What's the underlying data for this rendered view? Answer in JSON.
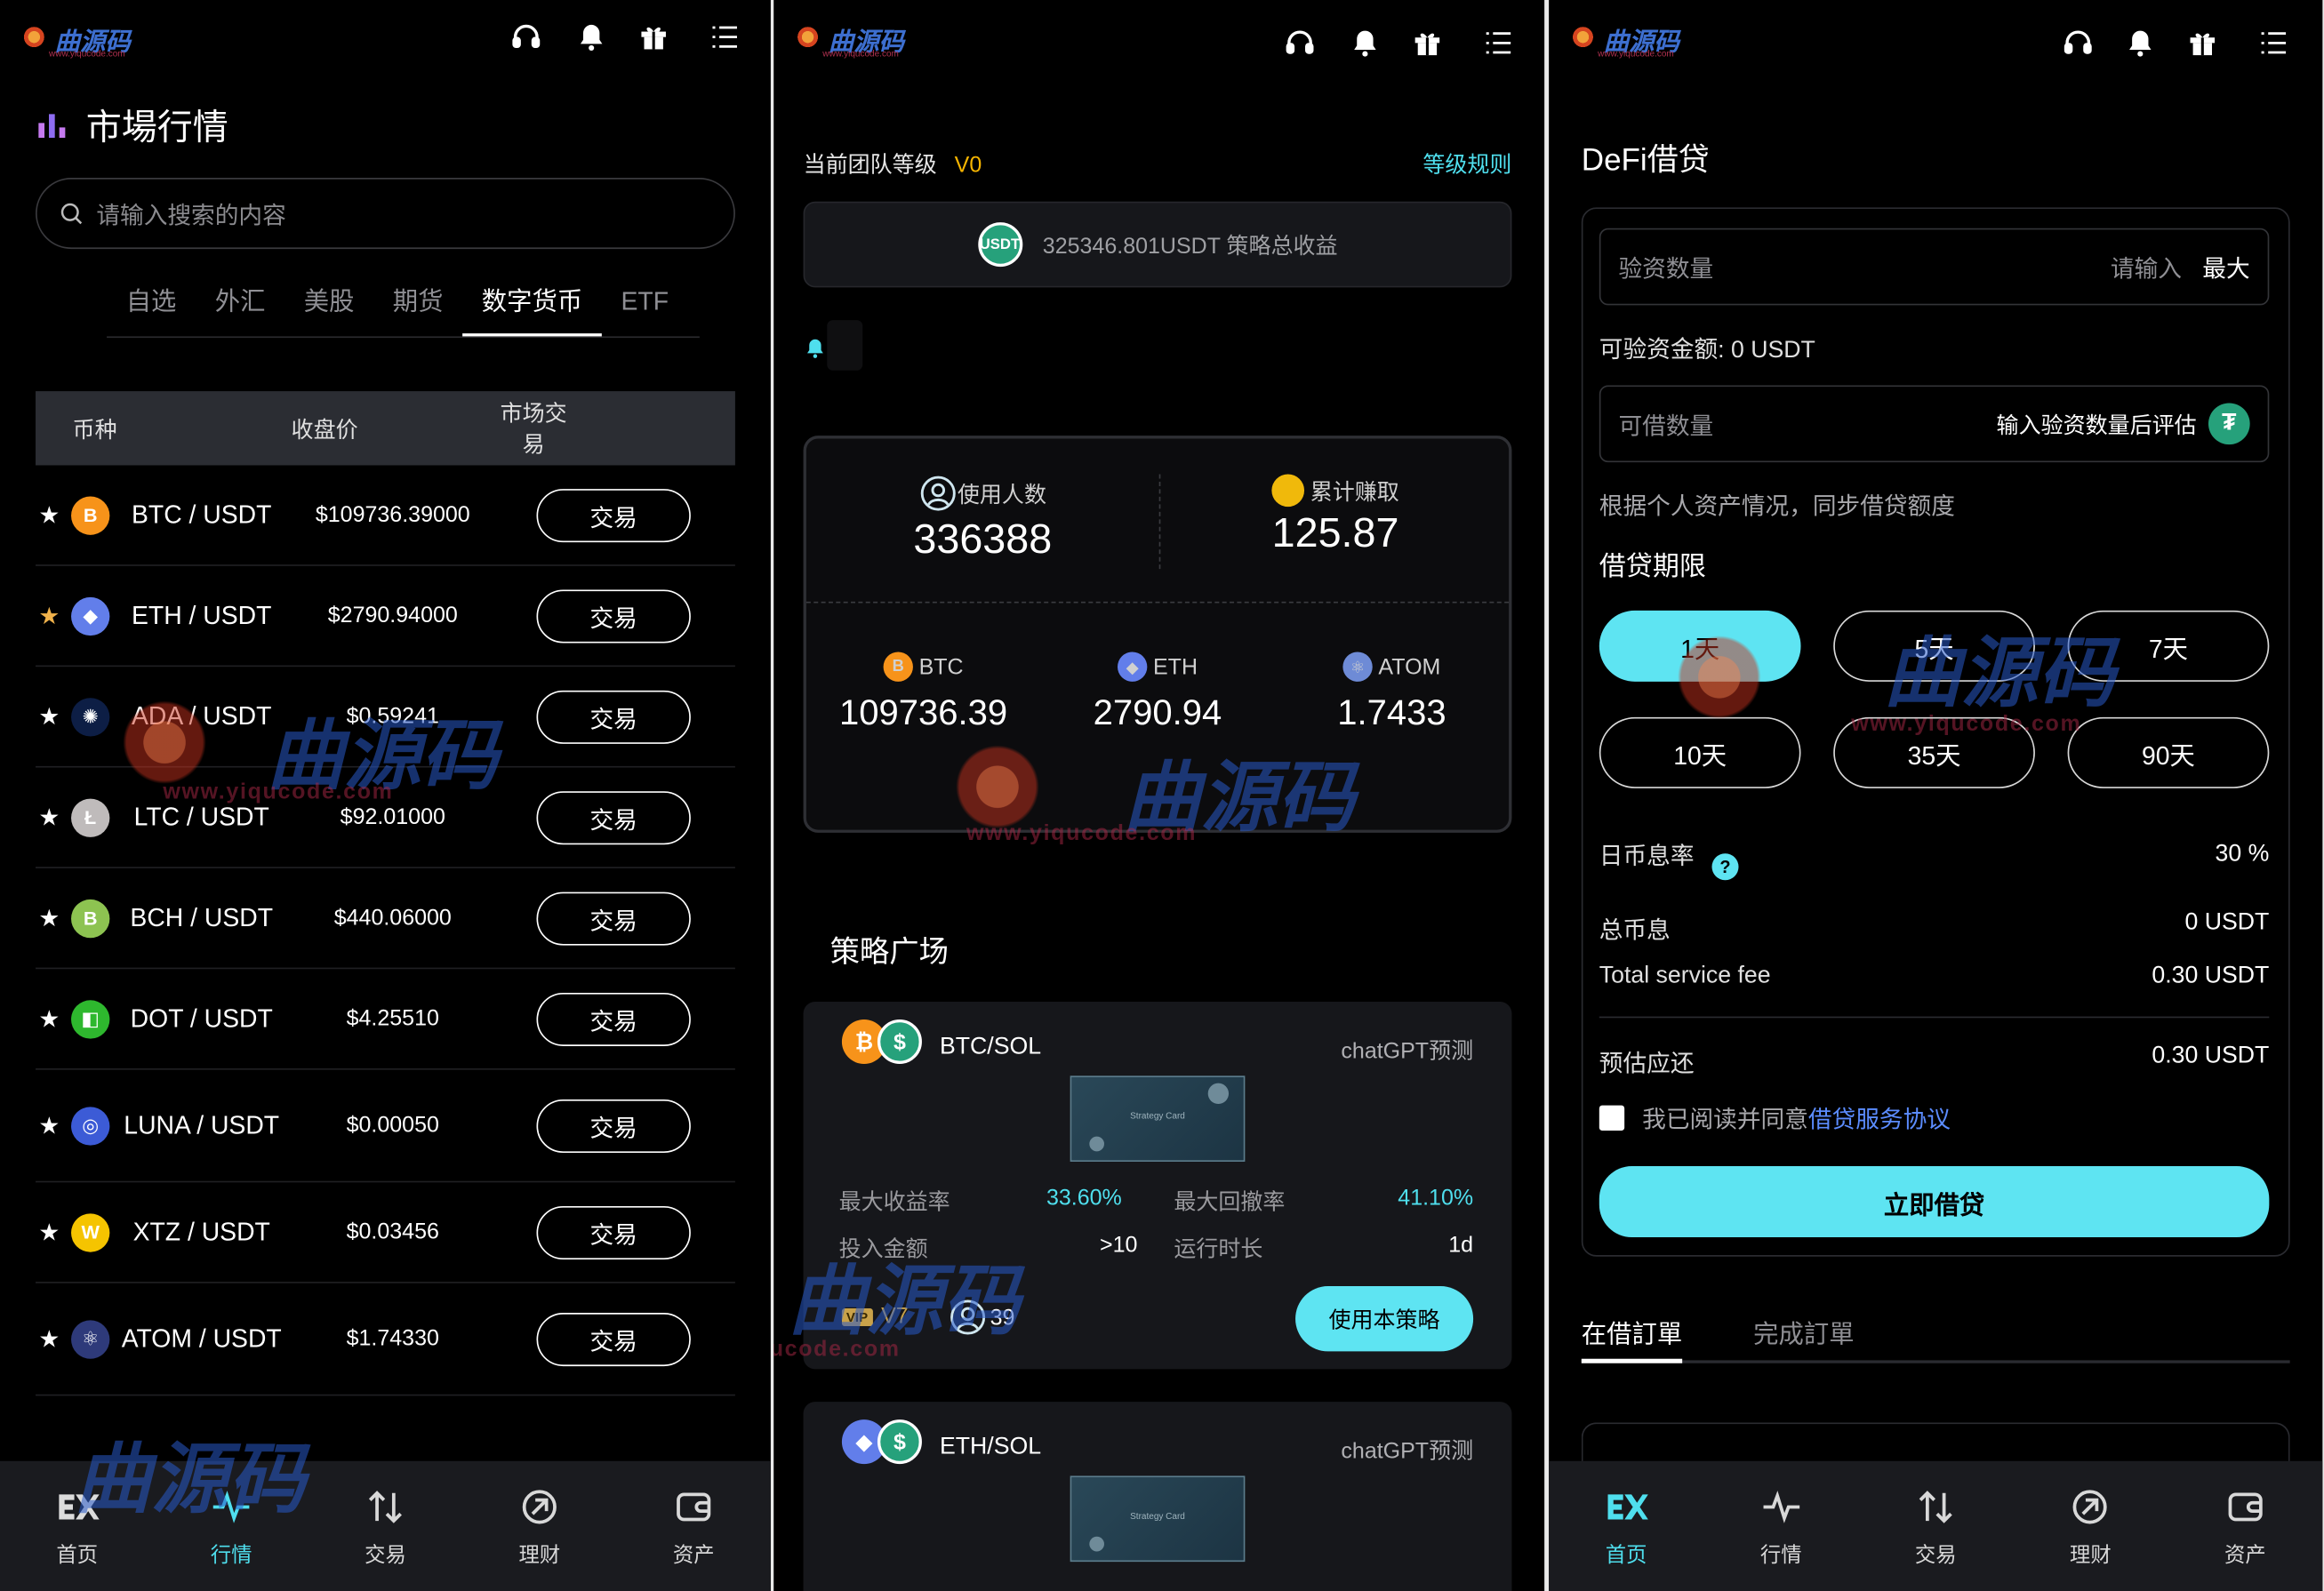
{
  "header_icons": [
    "headset-icon",
    "bell-icon",
    "gift-icon",
    "menu-icon"
  ],
  "watermark": {
    "text": "曲源码",
    "url": "www.yiqucode.com"
  },
  "market": {
    "title": "市場行情",
    "search_placeholder": "请输入搜索的内容",
    "categories": [
      "自选",
      "外汇",
      "美股",
      "期货",
      "数字货币",
      "ETF"
    ],
    "active_category": "数字货币",
    "columns": [
      "币种",
      "收盘价",
      "市场交易"
    ],
    "trade_label": "交易",
    "rows": [
      {
        "pair": "BTC / USDT",
        "price": "$109736.39000",
        "icon": "B",
        "color": "#f7931a",
        "fav": false
      },
      {
        "pair": "ETH / USDT",
        "price": "$2790.94000",
        "icon": "◆",
        "color": "#627eea",
        "fav": true
      },
      {
        "pair": "ADA / USDT",
        "price": "$0.59241",
        "icon": "✺",
        "color": "#0d1e45",
        "fav": false
      },
      {
        "pair": "LTC / USDT",
        "price": "$92.01000",
        "icon": "Ł",
        "color": "#bfbbbb",
        "fav": false
      },
      {
        "pair": "BCH / USDT",
        "price": "$440.06000",
        "icon": "B",
        "color": "#8dc351",
        "fav": false
      },
      {
        "pair": "DOT / USDT",
        "price": "$4.25510",
        "icon": "◧",
        "color": "#2eb82e",
        "fav": false
      },
      {
        "pair": "LUNA / USDT",
        "price": "$0.00050",
        "icon": "◎",
        "color": "#3c5bd6",
        "fav": false
      },
      {
        "pair": "XTZ / USDT",
        "price": "$0.03456",
        "icon": "W",
        "color": "#f5c400",
        "fav": false
      },
      {
        "pair": "ATOM / USDT",
        "price": "$1.74330",
        "icon": "⚛",
        "color": "#2e3a7a",
        "fav": false
      }
    ]
  },
  "tabs_left": [
    {
      "label": "首页",
      "icon": "ex-logo-icon"
    },
    {
      "label": "行情",
      "icon": "pulse-icon"
    },
    {
      "label": "交易",
      "icon": "swap-icon"
    },
    {
      "label": "理财",
      "icon": "finance-icon"
    },
    {
      "label": "资产",
      "icon": "wallet-icon"
    }
  ],
  "team": {
    "level_label": "当前团队等级",
    "level": "V0",
    "rules_link": "等级规则",
    "total_earn": "325346.801USDT 策略总收益",
    "usdt_badge": "USDT",
    "users_label": "使用人数",
    "users": "336388",
    "earned_label": "累计赚取",
    "earned": "125.87",
    "prices": [
      {
        "name": "BTC",
        "value": "109736.39",
        "color": "#f7931a",
        "icon": "B"
      },
      {
        "name": "ETH",
        "value": "2790.94",
        "color": "#627eea",
        "icon": "◆"
      },
      {
        "name": "ATOM",
        "value": "1.7433",
        "color": "#6e8bd6",
        "icon": "⚛"
      }
    ],
    "plaza_title": "策略广场",
    "strategies": [
      {
        "pair": "BTC/SOL",
        "tag": "chatGPT预测",
        "thumb": "Strategy Card",
        "max_return_label": "最大收益率",
        "max_return": "33.60%",
        "max_dd_label": "最大回撤率",
        "max_dd": "41.10%",
        "invest_label": "投入金额",
        "invest": ">10",
        "runtime_label": "运行时长",
        "runtime": "1d",
        "vip": "V7",
        "users": "39",
        "use_btn": "使用本策略"
      },
      {
        "pair": "ETH/SOL",
        "tag": "chatGPT预测",
        "thumb": "Strategy Card"
      }
    ]
  },
  "defi": {
    "title": "DeFi借贷",
    "verify_label": "验资数量",
    "verify_placeholder": "请输入",
    "max_btn": "最大",
    "available": "可验资金额: 0 USDT",
    "borrow_label": "可借数量",
    "borrow_hint": "输入验资数量后评估",
    "note": "根据个人资产情况，同步借贷额度",
    "period_title": "借贷期限",
    "periods": [
      "1天",
      "5天",
      "7天",
      "10天",
      "35天",
      "90天"
    ],
    "selected_period": "1天",
    "rate_label": "日币息率",
    "rate": "30 %",
    "total_interest_label": "总币息",
    "total_interest": "0 USDT",
    "fee_label": "Total service fee",
    "fee": "0.30 USDT",
    "due_label": "预估应还",
    "due": "0.30 USDT",
    "agree_text": "我已阅读并同意",
    "agree_link": "借贷服务协议",
    "submit": "立即借贷",
    "order_tabs": [
      "在借訂單",
      "完成訂單"
    ]
  },
  "tabs_right": [
    {
      "label": "首页"
    },
    {
      "label": "行情"
    },
    {
      "label": "交易"
    },
    {
      "label": "理财"
    },
    {
      "label": "资产"
    }
  ],
  "colors": {
    "accent": "#5ee4f2",
    "gold": "#f7b500",
    "bg": "#000000"
  }
}
